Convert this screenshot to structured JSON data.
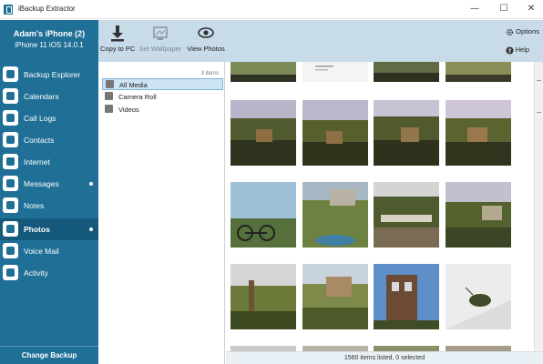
{
  "window": {
    "title": "iBackup Extractor",
    "controls": {
      "minimize": "—",
      "maximize": "☐",
      "close": "✕"
    }
  },
  "device": {
    "name": "Adam's iPhone (2)",
    "model": "iPhone 11 iOS 14.0.1"
  },
  "toolbar": {
    "copy_label": "Copy to PC",
    "wallpaper_label": "Set Wallpaper",
    "view_label": "View Photos",
    "options_label": "Options",
    "help_label": "Help"
  },
  "sidebar": {
    "items": [
      {
        "label": "Backup Explorer",
        "icon": "backup-explorer-icon",
        "active": false,
        "dot": false
      },
      {
        "label": "Calendars",
        "icon": "calendar-icon",
        "active": false,
        "dot": false
      },
      {
        "label": "Call Logs",
        "icon": "phone-icon",
        "active": false,
        "dot": false
      },
      {
        "label": "Contacts",
        "icon": "contacts-icon",
        "active": false,
        "dot": false
      },
      {
        "label": "Internet",
        "icon": "globe-icon",
        "active": false,
        "dot": false
      },
      {
        "label": "Messages",
        "icon": "message-icon",
        "active": false,
        "dot": true
      },
      {
        "label": "Notes",
        "icon": "notes-icon",
        "active": false,
        "dot": false
      },
      {
        "label": "Photos",
        "icon": "photos-icon",
        "active": true,
        "dot": true
      },
      {
        "label": "Voice Mail",
        "icon": "voicemail-icon",
        "active": false,
        "dot": false
      },
      {
        "label": "Activity",
        "icon": "activity-icon",
        "active": false,
        "dot": false
      }
    ],
    "change_backup": "Change Backup"
  },
  "folders": {
    "count": "3 items",
    "items": [
      {
        "label": "All Media",
        "selected": true
      },
      {
        "label": "Camera Roll",
        "selected": false
      },
      {
        "label": "Videos",
        "selected": false
      }
    ]
  },
  "status": {
    "text": "1560 items listed, 0 selected"
  },
  "colors": {
    "accent": "#1f6f96",
    "toolbar": "#c7dbe9",
    "selection": "#cde4f4"
  }
}
